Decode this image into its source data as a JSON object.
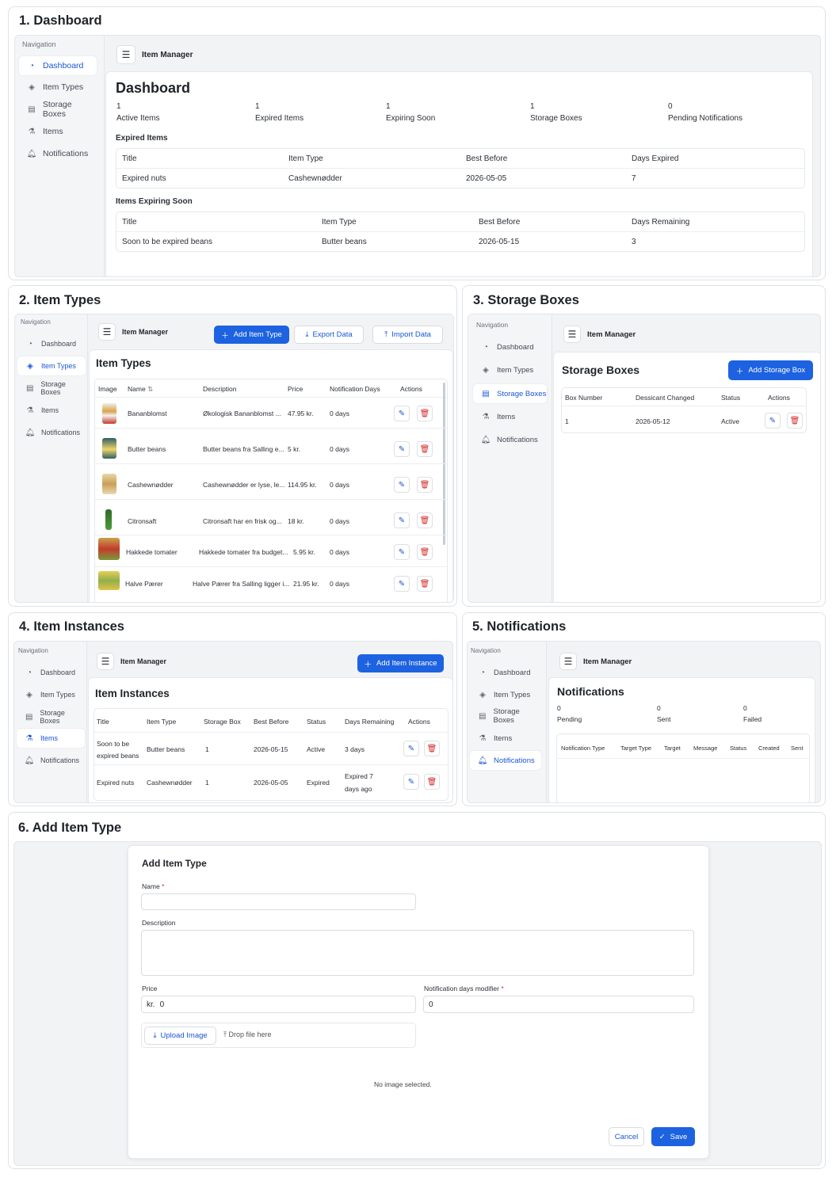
{
  "app": {
    "title": "Item Manager",
    "nav_title": "Navigation"
  },
  "nav": {
    "dashboard": "Dashboard",
    "item_types": "Item Types",
    "storage_boxes": "Storage Boxes",
    "items": "Items",
    "notifications": "Notifications"
  },
  "icons": {
    "dashboard": "gauge-icon",
    "item_types": "tag-icon",
    "storage_boxes": "box-icon",
    "items": "items-icon",
    "notifications": "bell-icon",
    "menu": "hamburger-icon",
    "edit": "edit-icon",
    "delete": "trash-icon",
    "plus": "plus-icon",
    "download": "download-icon",
    "upload": "upload-icon",
    "check": "check-icon"
  },
  "colors": {
    "primary": "#1d62e0",
    "danger": "#d42b2b",
    "active_nav": "#1a56d6"
  },
  "sections": {
    "s1": "1. Dashboard",
    "s2": "2. Item Types",
    "s3": "3. Storage Boxes",
    "s4": "4. Item Instances",
    "s5": "5. Notifications",
    "s6": "6. Add Item Type"
  },
  "dashboard": {
    "title": "Dashboard",
    "stats": [
      {
        "value": "1",
        "label": "Active Items"
      },
      {
        "value": "1",
        "label": "Expired Items"
      },
      {
        "value": "1",
        "label": "Expiring Soon"
      },
      {
        "value": "1",
        "label": "Storage Boxes"
      },
      {
        "value": "0",
        "label": "Pending Notifications"
      }
    ],
    "expired": {
      "title": "Expired Items",
      "headers": [
        "Title",
        "Item Type",
        "Best Before",
        "Days Expired"
      ],
      "rows": [
        [
          "Expired nuts",
          "Cashewnødder",
          "2026-05-05",
          "7"
        ]
      ]
    },
    "expiring": {
      "title": "Items Expiring Soon",
      "headers": [
        "Title",
        "Item Type",
        "Best Before",
        "Days Remaining"
      ],
      "rows": [
        [
          "Soon to be expired beans",
          "Butter beans",
          "2026-05-15",
          "3"
        ]
      ]
    }
  },
  "item_types": {
    "title": "Item Types",
    "add": "Add Item Type",
    "export": "Export Data",
    "import": "Import Data",
    "headers": [
      "Image",
      "Name",
      "Description",
      "Price",
      "Notification Days",
      "Actions"
    ],
    "rows": [
      [
        "Bananblomst",
        "Økologisk Bananblomst ...",
        "47.95 kr.",
        "0 days"
      ],
      [
        "Butter beans",
        "Butter beans fra Salling e...",
        "5 kr.",
        "0 days"
      ],
      [
        "Cashewnødder",
        "Cashewnødder er lyse, le...",
        "114.95 kr.",
        "0 days"
      ],
      [
        "Citronsaft",
        "Citronsaft har en frisk og...",
        "18 kr.",
        "0 days"
      ],
      [
        "Hakkede tomater",
        "Hakkede tomater fra budget...",
        "5.95 kr.",
        "0 days"
      ],
      [
        "Halve Pærer",
        "Halve Pærer fra Salling ligger i...",
        "21.95 kr.",
        "0 days"
      ]
    ]
  },
  "storage_boxes": {
    "title": "Storage Boxes",
    "add": "Add Storage Box",
    "headers": [
      "Box Number",
      "Dessicant Changed",
      "Status",
      "Actions"
    ],
    "rows": [
      [
        "1",
        "2026-05-12",
        "Active"
      ]
    ]
  },
  "instances": {
    "title": "Item Instances",
    "add": "Add Item Instance",
    "headers": [
      "Title",
      "Item Type",
      "Storage Box",
      "Best Before",
      "Status",
      "Days Remaining",
      "Actions"
    ],
    "rows": [
      [
        "Soon to be",
        "expired beans",
        "Butter beans",
        "1",
        "2026-05-15",
        "Active",
        "3 days",
        ""
      ],
      [
        "Expired nuts",
        "",
        "Cashewnødder",
        "1",
        "2026-05-05",
        "Expired",
        "Expired 7",
        "days ago"
      ]
    ]
  },
  "notifications": {
    "title": "Notifications",
    "stats": [
      {
        "value": "0",
        "label": "Pending"
      },
      {
        "value": "0",
        "label": "Sent"
      },
      {
        "value": "0",
        "label": "Failed"
      }
    ],
    "headers": [
      "Notification Type",
      "Target Type",
      "Target",
      "Message",
      "Status",
      "Created",
      "Sent"
    ]
  },
  "form": {
    "title": "Add Item Type",
    "name_label": "Name",
    "description_label": "Description",
    "price_label": "Price",
    "price_prefix": "kr.",
    "price_value": "0",
    "notif_label": "Notification days modifier",
    "notif_value": "0",
    "upload": "Upload Image",
    "drop": "Drop file here",
    "no_image": "No image selected.",
    "cancel": "Cancel",
    "save": "Save",
    "required": "*"
  }
}
